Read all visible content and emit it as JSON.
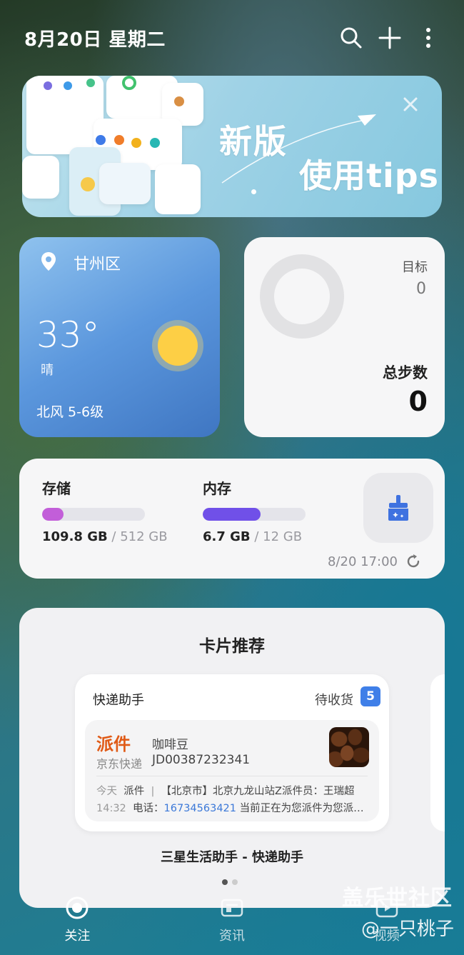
{
  "header": {
    "date": "8月20日 星期二",
    "icons": [
      "search-icon",
      "add-icon",
      "more-icon"
    ]
  },
  "banner": {
    "title_line1": "新版",
    "title_line2": "使用tips"
  },
  "weather": {
    "location": "甘州区",
    "temperature": "33°",
    "condition": "晴",
    "wind": "北风 5-6级"
  },
  "steps": {
    "goal_label": "目标",
    "goal_value": "0",
    "total_label": "总步数",
    "total_value": "0"
  },
  "device": {
    "storage": {
      "label": "存储",
      "used": "109.8 GB",
      "sep": " / ",
      "total": "512 GB",
      "fraction": 0.21,
      "color": "#c25ed9"
    },
    "memory": {
      "label": "内存",
      "used": "6.7 GB",
      "sep": " / ",
      "total": "12 GB",
      "fraction": 0.56,
      "color": "#7050e8"
    },
    "updated": "8/20 17:00"
  },
  "recommend": {
    "title": "卡片推荐",
    "card": {
      "title": "快递助手",
      "pending_label": "待收货",
      "pending_count": "5",
      "status": "派件",
      "company": "京东快递",
      "item": "咖啡豆",
      "tracking_no": "JD00387232341",
      "time_day": "今天",
      "time_clock": "14:32",
      "event": "派件",
      "detail_1": "【北京市】北京九龙山站Z派件员：王瑞超",
      "phone_label": "电话：",
      "phone": "16734563421",
      "detail_2": "当前正在为您派件为您派…"
    },
    "caption": "三星生活助手 - 快递助手"
  },
  "nav": {
    "items": [
      {
        "label": "关注",
        "icon": "target-icon"
      },
      {
        "label": "资讯",
        "icon": "news-icon"
      },
      {
        "label": "视频",
        "icon": "video-icon"
      }
    ]
  },
  "watermark": {
    "line1": "盖乐世社区",
    "line2": "@一只桃子"
  }
}
